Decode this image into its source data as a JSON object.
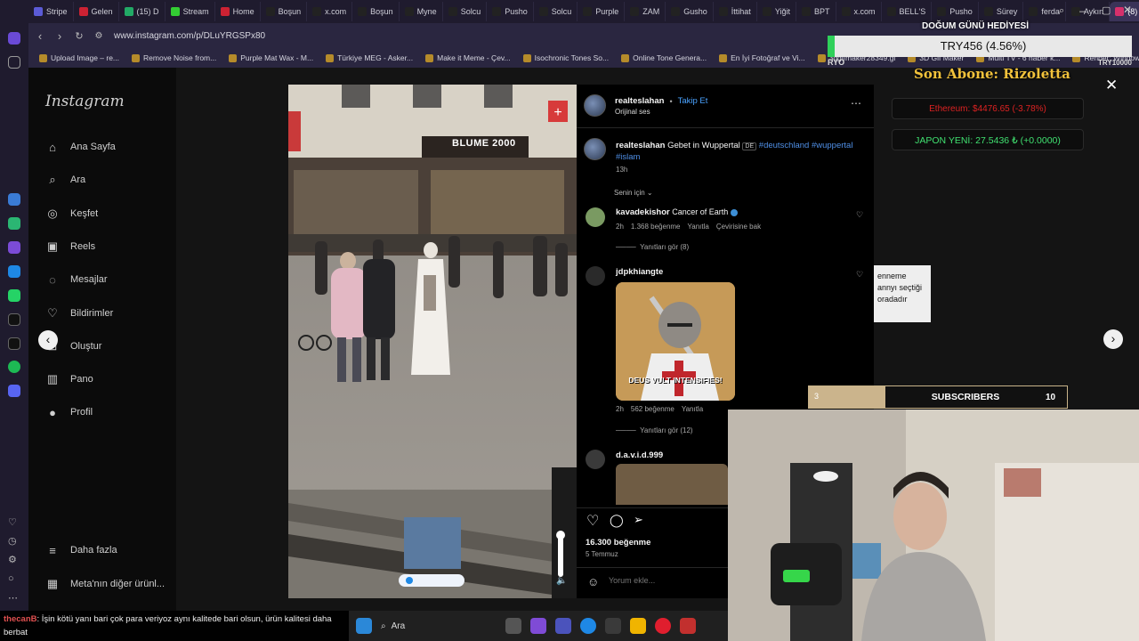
{
  "browser": {
    "tabs": [
      {
        "label": "Stripe",
        "color": "#5b5bd6"
      },
      {
        "label": "Gelen",
        "color": "#c23"
      },
      {
        "label": "(15) D",
        "color": "#2a6"
      },
      {
        "label": "Stream",
        "color": "#3c3"
      },
      {
        "label": "Home",
        "color": "#c23"
      },
      {
        "label": "Boşun",
        "color": "#222"
      },
      {
        "label": "x.com",
        "color": "#222"
      },
      {
        "label": "Boşun",
        "color": "#222"
      },
      {
        "label": "Myne",
        "color": "#222"
      },
      {
        "label": "Solcu",
        "color": "#222"
      },
      {
        "label": "Pusho",
        "color": "#222"
      },
      {
        "label": "Solcu",
        "color": "#222"
      },
      {
        "label": "Purple",
        "color": "#222"
      },
      {
        "label": "ZAM",
        "color": "#222"
      },
      {
        "label": "Gusho",
        "color": "#222"
      },
      {
        "label": "İttihat",
        "color": "#222"
      },
      {
        "label": "Yiğit",
        "color": "#222"
      },
      {
        "label": "BPT",
        "color": "#222"
      },
      {
        "label": "x.com",
        "color": "#222"
      },
      {
        "label": "BELL'S",
        "color": "#222"
      },
      {
        "label": "Pusho",
        "color": "#222"
      },
      {
        "label": "Sürey",
        "color": "#222"
      },
      {
        "label": "ferda",
        "color": "#222"
      },
      {
        "label": "Aykın",
        "color": "#222"
      },
      {
        "label": "(8) Insta",
        "color": "#d6306b",
        "active": true
      }
    ],
    "url": "www.instagram.com/p/DLuYRGSPx80",
    "bookmarks": [
      "Upload Image – re...",
      "Remove Noise from...",
      "Purple Mat Wax - M...",
      "Türkiye MEG - Asker...",
      "Make it Meme - Çev...",
      "Isochronic Tones So...",
      "Online Tone Genera...",
      "En İyi Fotoğraf ve Vi...",
      "3dgifmaker28349.gi",
      "3D Gif Maker",
      "Multi TV - 6 haber k...",
      "Rehber: Windows T..."
    ]
  },
  "instagram": {
    "logo": "Instagram",
    "nav": [
      {
        "label": "Ana Sayfa",
        "icon": "home-icon",
        "glyph": "⌂"
      },
      {
        "label": "Ara",
        "icon": "search-icon",
        "glyph": "⌕"
      },
      {
        "label": "Keşfet",
        "icon": "compass-icon",
        "glyph": "◎"
      },
      {
        "label": "Reels",
        "icon": "reels-icon",
        "glyph": "▣"
      },
      {
        "label": "Mesajlar",
        "icon": "messenger-icon",
        "glyph": "◌"
      },
      {
        "label": "Bildirimler",
        "icon": "heart-icon",
        "glyph": "♡"
      },
      {
        "label": "Oluştur",
        "icon": "plus-icon",
        "glyph": "⊞"
      },
      {
        "label": "Pano",
        "icon": "dashboard-icon",
        "glyph": "▥"
      },
      {
        "label": "Profil",
        "icon": "profile-icon",
        "glyph": "●"
      }
    ],
    "more": "Daha fazla",
    "meta": "Meta'nın diğer ürünl..."
  },
  "post": {
    "author": "realteslahan",
    "follow": "Takip Et",
    "audio": "Orijinal ses",
    "caption_user": "realteslahan",
    "caption_text": "Gebet in Wuppertal",
    "caption_flag": "DE",
    "hashtags": "#deutschland #wuppertal",
    "hashtag2": "#islam",
    "time": "13h",
    "sort": "Senin için",
    "shop_sign": "BLUME 2000",
    "likes": "16.300 beğenme",
    "date": "5 Temmuz",
    "comment_placeholder": "Yorum ekle...",
    "comments": [
      {
        "user": "kavadekishor",
        "text": "Cancer of Earth",
        "meta": "2h",
        "likes": "1.368 beğenme",
        "reply": "Yanıtla",
        "translate": "Çevirisine bak",
        "replies": "Yanıtları gör (8)"
      },
      {
        "user": "jdpkhiangte",
        "meme_text": "DEUS VULT INTENSIFIES!",
        "meta": "2h",
        "likes": "562 beğenme",
        "reply": "Yanıtla",
        "replies": "Yanıtları gör (12)"
      },
      {
        "user": "d.a.v.i.d.999"
      }
    ]
  },
  "stream": {
    "gift_title": "DOĞUM GÜNÜ HEDİYESİ",
    "ticker": "TRY456 (4.56%)",
    "ticker_left": "RYO",
    "ticker_right": "TRY10000",
    "last_sub": "Son Abone: Rizoletta",
    "eth": "Ethereum: $4476.65 (-3.78%)",
    "jpy": "JAPON YENİ: 27.5436 ₺ (+0.0000)",
    "subs_left": "3",
    "subs_label": "SUBSCRIBERS",
    "subs_right": "10",
    "bg_text1": "enneme",
    "bg_text2": "annyı seçtiği",
    "bg_text3": "oradadır",
    "chat_user": "thecanB",
    "chat_text": ": İşin kötü yanı bari çok para veriyoz aynı kalitede bari olsun, ürün kalitesi daha berbat",
    "taskbar_search": "Ara"
  }
}
